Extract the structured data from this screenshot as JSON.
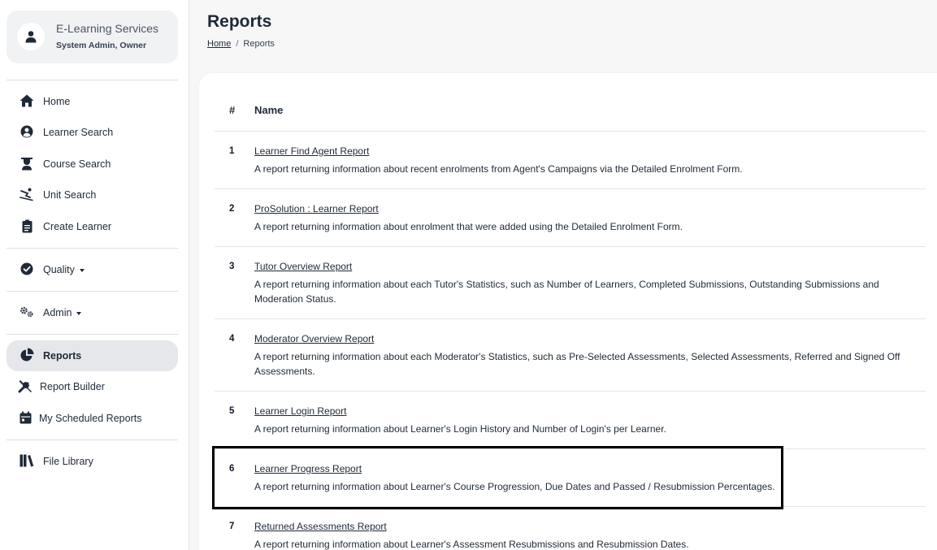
{
  "user": {
    "org_name": "E-Learning Services",
    "role": "System Admin, Owner"
  },
  "sidebar": {
    "items": [
      {
        "label": "Home",
        "icon": "home-icon"
      },
      {
        "label": "Learner Search",
        "icon": "user-circle-icon"
      },
      {
        "label": "Course Search",
        "icon": "graduation-icon"
      },
      {
        "label": "Unit Search",
        "icon": "skier-icon"
      },
      {
        "label": "Create Learner",
        "icon": "clipboard-icon"
      },
      {
        "label": "Quality",
        "icon": "check-circle-icon"
      },
      {
        "label": "Admin",
        "icon": "cogs-icon"
      },
      {
        "label": "Reports",
        "icon": "pie-chart-icon"
      },
      {
        "label": "Report Builder",
        "icon": "tools-icon"
      },
      {
        "label": "My Scheduled Reports",
        "icon": "calendar-icon"
      },
      {
        "label": "File Library",
        "icon": "books-icon"
      }
    ]
  },
  "page": {
    "title": "Reports"
  },
  "breadcrumb": {
    "home": "Home",
    "separator": "/",
    "current": "Reports"
  },
  "table": {
    "headers": {
      "num": "#",
      "name": "Name"
    },
    "rows": [
      {
        "num": "1",
        "name": "Learner Find Agent Report",
        "desc": "A report returning information about recent enrolments from Agent's Campaigns via the Detailed Enrolment Form."
      },
      {
        "num": "2",
        "name": "ProSolution : Learner Report",
        "desc": "A report returning information about enrolment that were added using the Detailed Enrolment Form."
      },
      {
        "num": "3",
        "name": "Tutor Overview Report",
        "desc": "A report returning information about each Tutor's Statistics, such as Number of Learners, Completed Submissions, Outstanding Submissions and Moderation Status."
      },
      {
        "num": "4",
        "name": "Moderator Overview Report",
        "desc": "A report returning information about each Moderator's Statistics, such as Pre-Selected Assessments, Selected Assessments, Referred and Signed Off Assessments."
      },
      {
        "num": "5",
        "name": "Learner Login Report",
        "desc": "A report returning information about Learner's Login History and Number of Login's per Learner."
      },
      {
        "num": "6",
        "name": "Learner Progress Report",
        "desc": "A report returning information about Learner's Course Progression, Due Dates and Passed / Resubmission Percentages."
      },
      {
        "num": "7",
        "name": "Returned Assessments Report",
        "desc": "A report returning information about Learner's Assessment Resubmissions and Resubmission Dates."
      }
    ]
  },
  "colors": {
    "sidebar_active": "#e6e7ea",
    "highlight_border": "#000000",
    "text": "#1f2937"
  }
}
